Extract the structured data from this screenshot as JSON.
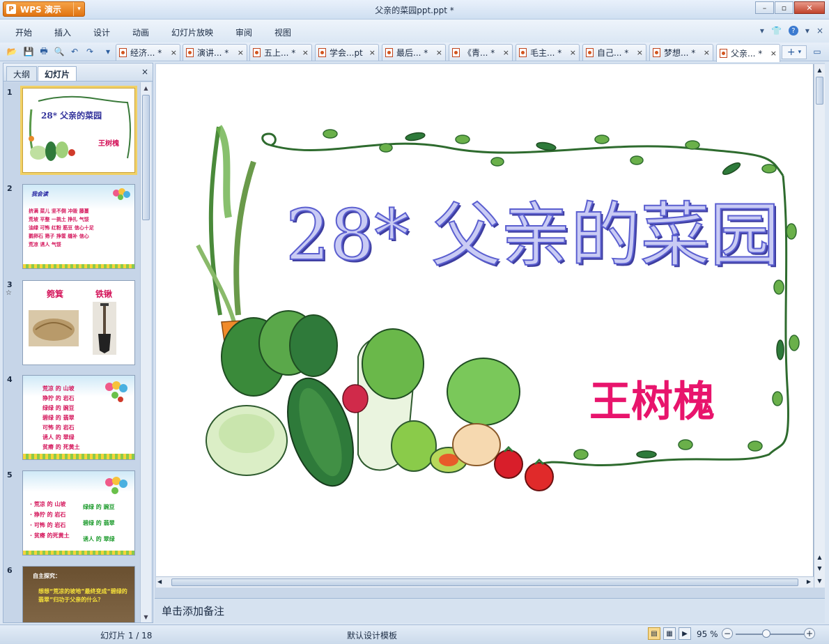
{
  "app": {
    "name": "WPS 演示",
    "window_title": "父亲的菜园ppt.ppt *"
  },
  "menu": [
    "开始",
    "插入",
    "设计",
    "动画",
    "幻灯片放映",
    "审阅",
    "视图"
  ],
  "doc_tabs": [
    {
      "label": "经济...",
      "modified": true
    },
    {
      "label": "演讲...",
      "modified": true
    },
    {
      "label": "五上...",
      "modified": true
    },
    {
      "label": "学会...pt",
      "modified": false
    },
    {
      "label": "最后...",
      "modified": true
    },
    {
      "label": "《青...",
      "modified": true
    },
    {
      "label": "毛主...",
      "modified": true
    },
    {
      "label": "自己...",
      "modified": true
    },
    {
      "label": "梦想...",
      "modified": true
    },
    {
      "label": "父亲...",
      "modified": true,
      "active": true
    }
  ],
  "modified_mark": "*",
  "left_panel": {
    "tabs": [
      "大纲",
      "幻灯片"
    ],
    "active_tab": "幻灯片",
    "close": "×"
  },
  "thumbnails": [
    {
      "num": "1",
      "title": "28* 父亲的菜园",
      "author": "王树槐"
    },
    {
      "num": "2",
      "heading": "我会读",
      "rows": [
        "挤满  菜儿  坚不倒  冲毁  藤蔓",
        "荒坡  平整  一挑土  挣扎  气馁",
        "油绿  可怖  红粉  筋豆  信心十足",
        "鹅卵石  筛子  挣筐  缝补  信心",
        "荒凉  诱人  气馁"
      ]
    },
    {
      "num": "3",
      "star": "☆",
      "labels": [
        "箢箕",
        "铁锹"
      ]
    },
    {
      "num": "4",
      "rows": [
        "荒凉 的 山坡",
        "狰狞 的 岩石",
        "绿绿 的 豌豆",
        "碧绿 的 翡翠",
        "可怖 的 岩石",
        "诱人 的 翠绿",
        "贫瘠 的 死黄土"
      ]
    },
    {
      "num": "5",
      "left": [
        "· 荒凉 的 山坡",
        "· 狰狞 的 岩石",
        "· 可怖 的 岩石",
        "· 贫瘠 的死黄土"
      ],
      "right": [
        "绿绿 的 豌豆",
        "碧绿 的 翡翠",
        "诱人 的 翠绿"
      ]
    },
    {
      "num": "6",
      "heading": "自主探究：",
      "text": "想想“荒凉的坡地”最终变成“碧绿的翡翠”归功于父亲的什么？"
    }
  ],
  "slide": {
    "title": "28* 父亲的菜园",
    "author": "王树槐",
    "colors": {
      "title": "#6b6fd6",
      "title_shadow": "#3e3ea0",
      "author": "#e8146c",
      "vine": "#2e6b2e"
    }
  },
  "notes_placeholder": "单击添加备注",
  "status": {
    "slide_info": "幻灯片 1 / 18",
    "template": "默认设计模板",
    "zoom": "95 %"
  },
  "glyphs": {
    "minimize": "–",
    "maximize": "▫",
    "close": "✕",
    "dropdown": "▾",
    "minus": "−",
    "plus": "+",
    "tab_close": "×"
  }
}
